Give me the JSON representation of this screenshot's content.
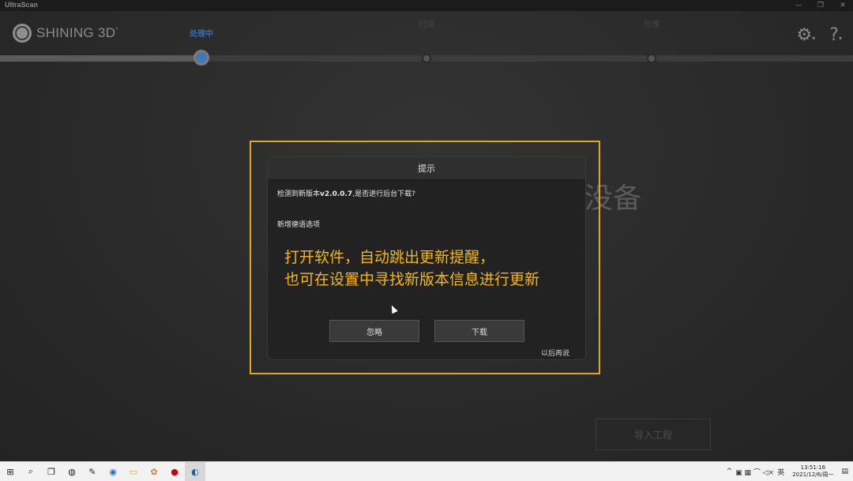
{
  "window": {
    "title": "UltraScan",
    "controls": [
      "—",
      "❐",
      "✕"
    ]
  },
  "header": {
    "brand": "SHINING 3D",
    "logo_suffix": "°",
    "steps": [
      {
        "label": "处理中",
        "state": "active"
      },
      {
        "label": "扫描",
        "state": "pending"
      },
      {
        "label": "处理",
        "state": "pending"
      }
    ],
    "icons": {
      "settings": "⚙",
      "settings_caret": "▾",
      "help": "?",
      "help_caret": "▾"
    }
  },
  "background": {
    "partial_text": "没备",
    "import_button": "导入工程"
  },
  "dialog": {
    "title": "提示",
    "message_prefix": "检测到新版本",
    "version": "v2.0.0.7",
    "message_suffix": ",是否进行后台下载?",
    "feature_note": "新增德语选项",
    "ignore_label": "忽略",
    "download_label": "下载",
    "later_label": "以后再说"
  },
  "annotation": {
    "line1": "打开软件，自动跳出更新提醒，",
    "line2": "也可在设置中寻找新版本信息进行更新",
    "color": "#f2b61c"
  },
  "taskbar": {
    "items": [
      {
        "name": "start",
        "glyph": "⊞"
      },
      {
        "name": "search",
        "glyph": "⌕"
      },
      {
        "name": "task-view",
        "glyph": "❐"
      },
      {
        "name": "app-1",
        "glyph": "◍"
      },
      {
        "name": "app-2",
        "glyph": "✎"
      },
      {
        "name": "edge",
        "glyph": "◉"
      },
      {
        "name": "explorer",
        "glyph": "▭"
      },
      {
        "name": "app-3",
        "glyph": "✿"
      },
      {
        "name": "record",
        "glyph": "●"
      },
      {
        "name": "ultrascan",
        "glyph": "◐"
      }
    ],
    "tray": {
      "chevron": "^",
      "lang": "英",
      "time": "13:51:16",
      "date": "2021/12/6/周一",
      "notify": "▤"
    }
  },
  "colors": {
    "accent": "#3f7ab6",
    "highlight_border": "#e0a81c"
  }
}
